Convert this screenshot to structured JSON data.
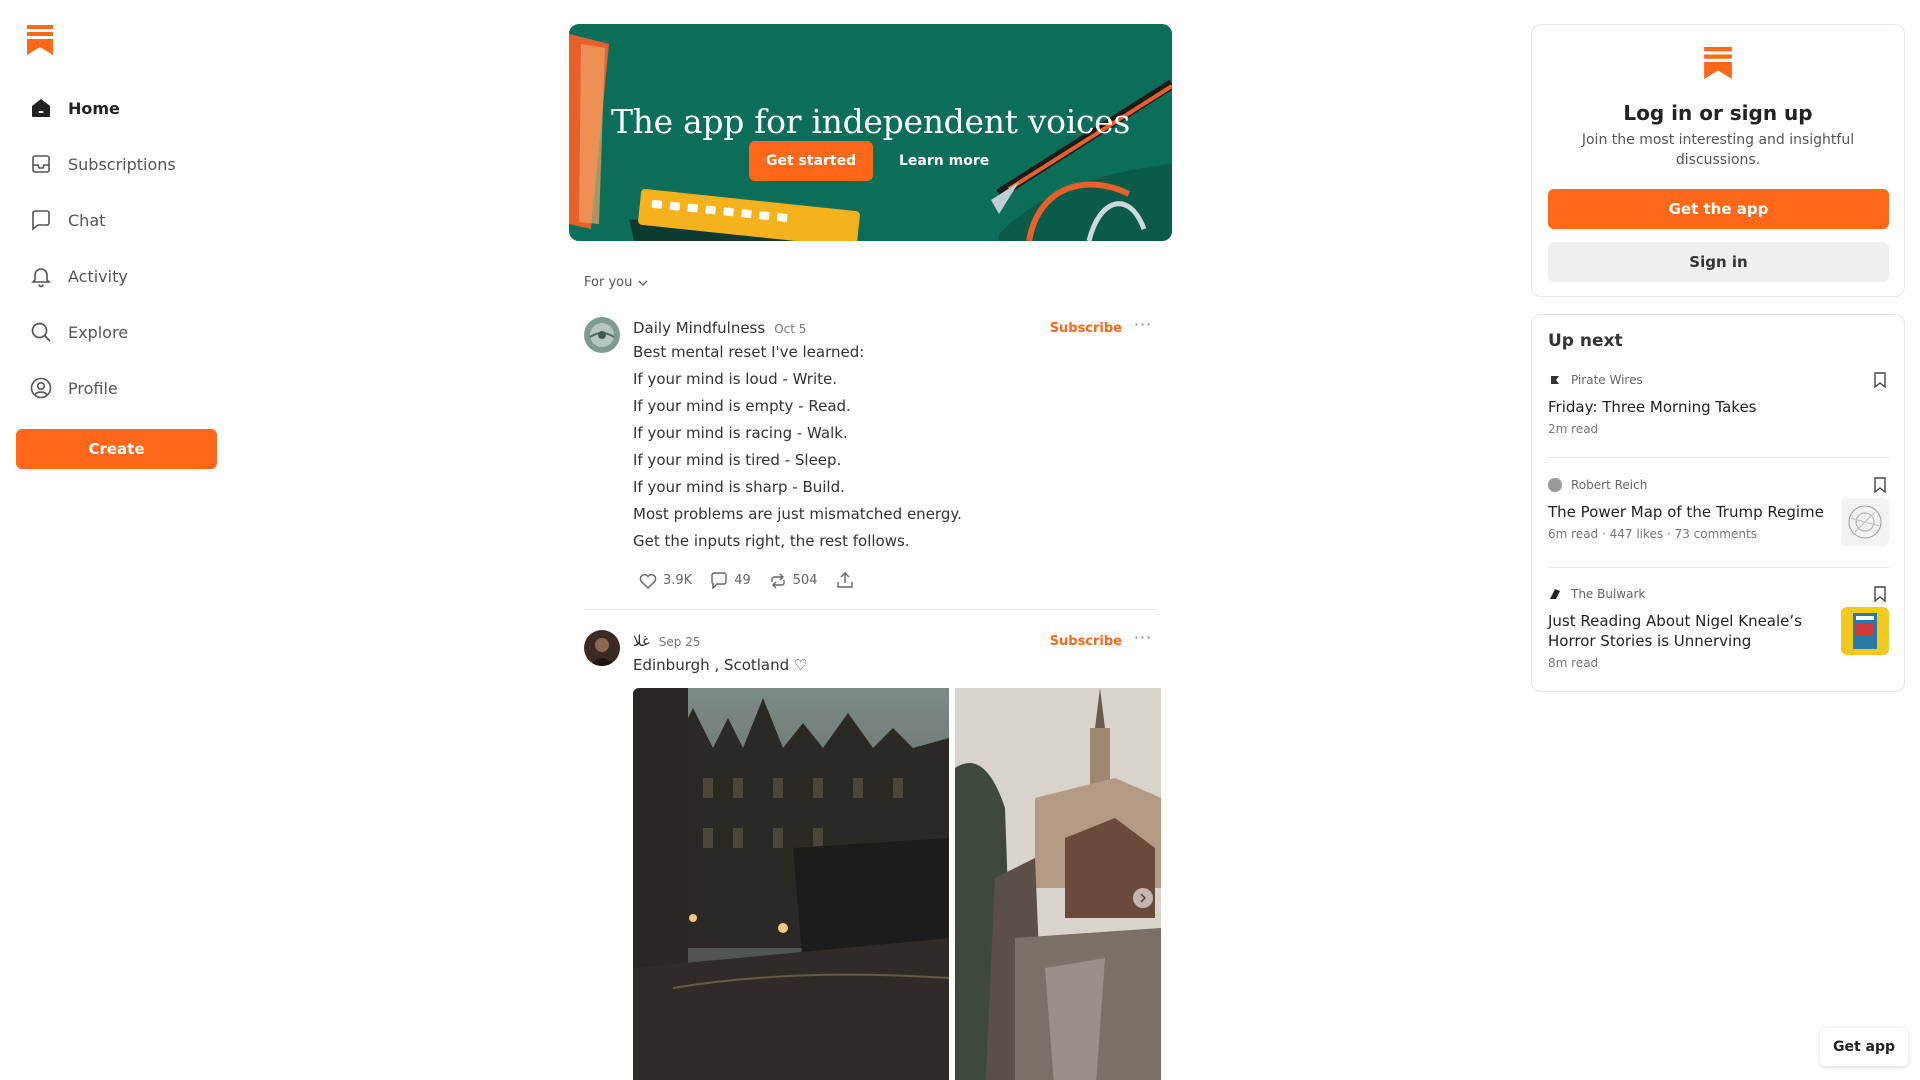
{
  "brand": {
    "accent": "#ff6719",
    "banner_bg": "#0b6e58"
  },
  "sidebar": {
    "items": [
      {
        "label": "Home",
        "icon": "home-icon",
        "active": true
      },
      {
        "label": "Subscriptions",
        "icon": "inbox-icon"
      },
      {
        "label": "Chat",
        "icon": "chat-bubble-icon"
      },
      {
        "label": "Activity",
        "icon": "bell-icon"
      },
      {
        "label": "Explore",
        "icon": "search-icon"
      },
      {
        "label": "Profile",
        "icon": "user-circle-icon"
      }
    ],
    "create_label": "Create"
  },
  "banner": {
    "title": "The app for independent voices",
    "cta_label": "Get started",
    "more_label": "Learn more"
  },
  "feed": {
    "filter_label": "For you",
    "posts": [
      {
        "author": "Daily Mindfulness",
        "date": "Oct 5",
        "subscribe_label": "Subscribe",
        "lines": [
          "Best mental reset I've learned:",
          "If your mind is loud - Write.",
          "If your mind is empty - Read.",
          "If your mind is racing - Walk.",
          "If your mind is tired - Sleep.",
          "If your mind is sharp - Build.",
          "Most problems are just mismatched energy.",
          "Get the inputs right, the rest follows."
        ],
        "likes": "3.9K",
        "comments": "49",
        "restacks": "504"
      },
      {
        "author": "غلا",
        "date": "Sep 25",
        "subscribe_label": "Subscribe",
        "caption": "Edinburgh , Scotland ♡"
      }
    ]
  },
  "auth": {
    "title": "Log in or sign up",
    "subtitle": "Join the most interesting and insightful discussions.",
    "app_label": "Get the app",
    "signin_label": "Sign in"
  },
  "upnext": {
    "title": "Up next",
    "items": [
      {
        "publication": "Pirate Wires",
        "title": "Friday: Three Morning Takes",
        "meta": "2m read"
      },
      {
        "publication": "Robert Reich",
        "title": "The Power Map of the Trump Regime",
        "meta": "6m read · 447 likes · 73 comments"
      },
      {
        "publication": "The Bulwark",
        "title": "Just Reading About Nigel Kneale’s Horror Stories is Unnerving",
        "meta": "8m read"
      }
    ]
  },
  "get_app_label": "Get app"
}
